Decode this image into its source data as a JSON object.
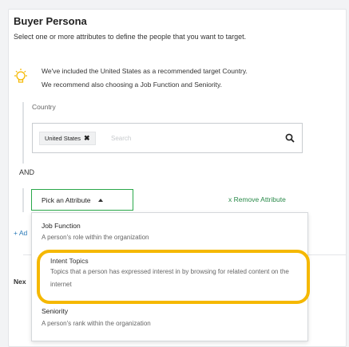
{
  "header": {
    "title": "Buyer Persona",
    "subtitle": "Select one or more attributes to define the people that you want to target."
  },
  "tip": {
    "line1": "We've included the United States as a recommended target Country.",
    "line2": "We recommend also choosing a Job Function and Seniority.",
    "icon": "lightbulb-icon"
  },
  "country": {
    "label": "Country",
    "chip_label": "United States",
    "chip_remove": "✖",
    "search_placeholder": "Search",
    "search_icon": "search-icon"
  },
  "and_label": "AND",
  "attribute": {
    "pick_label": "Pick an Attribute",
    "remove_label": "x Remove Attribute"
  },
  "add_label": "+ Ad",
  "next_label": "Nex",
  "dropdown": {
    "items": [
      {
        "title": "Job Function",
        "description": "A person's role within the organization"
      },
      {
        "title": "Intent Topics",
        "description": "Topics that a person has expressed interest in by browsing for related content on the internet"
      },
      {
        "title": "Seniority",
        "description": "A person's rank within the organization"
      }
    ]
  },
  "colors": {
    "accent_green": "#2aa84a",
    "highlight": "#f5b800",
    "link_blue": "#2a7ab8"
  }
}
